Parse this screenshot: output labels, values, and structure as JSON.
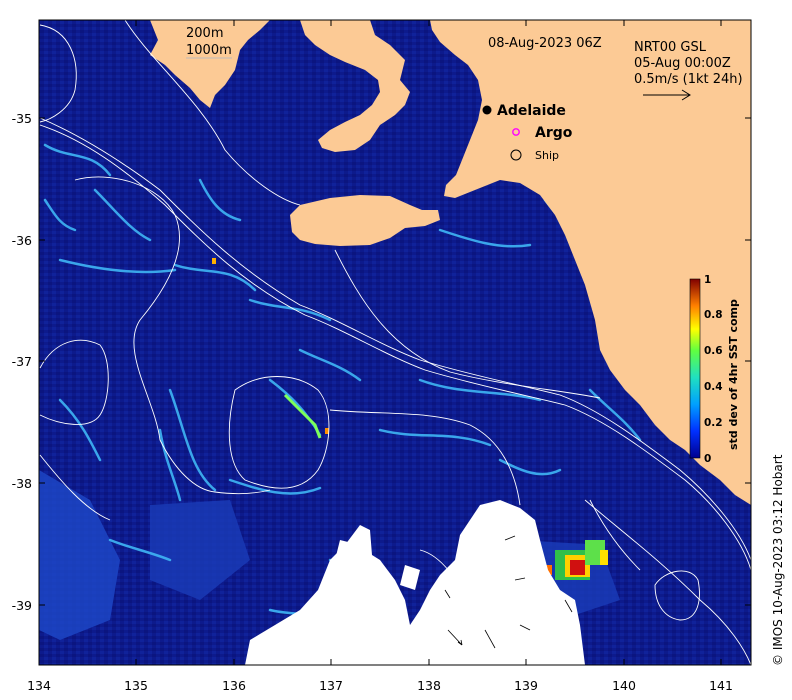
{
  "map": {
    "x_axis": {
      "ticks": [
        "134",
        "135",
        "136",
        "137",
        "138",
        "139",
        "140",
        "141"
      ]
    },
    "y_axis": {
      "ticks": [
        "-35",
        "-36",
        "-37",
        "-38",
        "-39"
      ]
    },
    "depth_legend": {
      "line1": "200m",
      "line2": "1000m"
    },
    "date_label": "08-Aug-2023 06Z",
    "current_legend": {
      "line1": "NRT00 GSL",
      "line2": "05-Aug 00:00Z",
      "line3": "0.5m/s (1kt 24h)"
    },
    "markers": {
      "adelaide": "Adelaide",
      "argo": "Argo",
      "ship": "Ship"
    },
    "colorbar": {
      "title": "std dev of 4hr SST comp",
      "ticks": [
        "0",
        "0.2",
        "0.4",
        "0.6",
        "0.8",
        "1"
      ]
    },
    "copyright": "© IMOS 10-Aug-2023 03:12 Hobart",
    "colors": {
      "ocean": "#0d1a8c",
      "land": "#fcca95",
      "gap": "#ffffff",
      "contour": "#ffffff",
      "argo": "#ff00ff"
    }
  }
}
